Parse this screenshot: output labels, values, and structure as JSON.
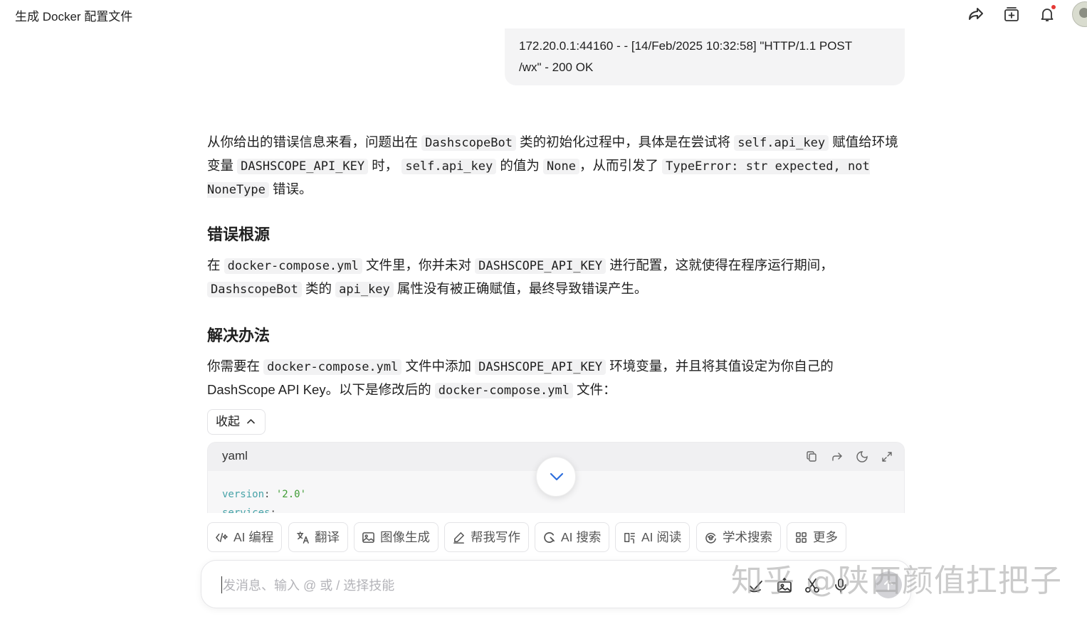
{
  "header": {
    "title": "生成 Docker 配置文件",
    "icons": [
      "share-icon",
      "new-chat-icon",
      "bell-icon",
      "avatar"
    ]
  },
  "user_message": {
    "line1": "172.20.0.1:44160 - - [14/Feb/2025 10:32:58] \"HTTP/1.1 POST",
    "line2": "/wx\" - 200 OK"
  },
  "answer": {
    "p1": {
      "t1": "从你给出的错误信息来看，问题出在 ",
      "c1": "DashscopeBot",
      "t2": " 类的初始化过程中，具体是在尝试将 ",
      "c2": "self.api_key",
      "t3": " 赋值给环境变量 ",
      "c3": "DASHSCOPE_API_KEY",
      "t4": " 时， ",
      "c4": "self.api_key",
      "t5": " 的值为 ",
      "c5": "None",
      "t6": "，从而引发了 ",
      "c6": "TypeError: str expected, not NoneType",
      "t7": " 错误。"
    },
    "h_root": "错误根源",
    "p2": {
      "t1": "在 ",
      "c1": "docker-compose.yml",
      "t2": " 文件里，你并未对 ",
      "c2": "DASHSCOPE_API_KEY",
      "t3": " 进行配置，这就使得在程序运行期间，",
      "c3": "DashscopeBot",
      "t4": " 类的 ",
      "c4": "api_key",
      "t5": " 属性没有被正确赋值，最终导致错误产生。"
    },
    "h_fix": "解决办法",
    "p3": {
      "t1": "你需要在 ",
      "c1": "docker-compose.yml",
      "t2": " 文件中添加 ",
      "c2": "DASHSCOPE_API_KEY",
      "t3": " 环境变量，并且将其值设定为你自己的 DashScope API Key。以下是修改后的 ",
      "c3": "docker-compose.yml",
      "t4": " 文件："
    },
    "collapse_label": "收起"
  },
  "code_block": {
    "language": "yaml",
    "line1_key": "version",
    "line1_sep": ": ",
    "line1_val": "'2.0'",
    "line2_key": "services",
    "line2_sep": ":",
    "tools": [
      "copy-icon",
      "share-code-icon",
      "theme-icon",
      "expand-icon"
    ]
  },
  "skills": [
    {
      "label": "AI 编程",
      "icon": "code-icon"
    },
    {
      "label": "翻译",
      "icon": "translate-icon"
    },
    {
      "label": "图像生成",
      "icon": "image-icon"
    },
    {
      "label": "帮我写作",
      "icon": "pen-icon"
    },
    {
      "label": "AI 搜索",
      "icon": "search-icon"
    },
    {
      "label": "AI 阅读",
      "icon": "read-icon"
    },
    {
      "label": "学术搜索",
      "icon": "academic-icon"
    },
    {
      "label": "更多",
      "icon": "grid-icon"
    }
  ],
  "input": {
    "placeholder": "发消息、输入 @ 或 / 选择技能",
    "tools": [
      "deep-think-icon",
      "upload-image-icon",
      "scissors-icon",
      "mic-icon",
      "send-icon"
    ]
  },
  "watermark": "知乎 @陕西颜值扛把子"
}
